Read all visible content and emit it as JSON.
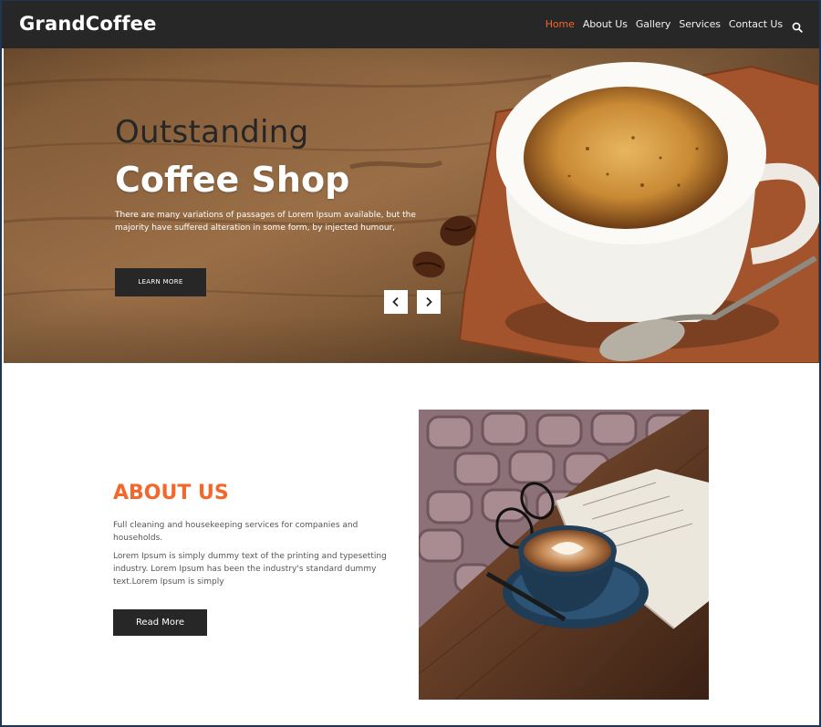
{
  "brand": {
    "name": "GrandCoffee"
  },
  "nav": {
    "items": [
      "Home",
      "About Us",
      "Gallery",
      "Services",
      "Contact Us"
    ],
    "active_index": 0,
    "search_icon": "search-icon"
  },
  "hero": {
    "subtitle": "Outstanding",
    "title": "Coffee Shop",
    "description": "There are many variations of passages of Lorem Ipsum available, but the majority have suffered alteration in some form, by injected humour,",
    "button_label": "LEARN MORE",
    "prev_icon": "chevron-left-icon",
    "next_icon": "chevron-right-icon"
  },
  "about": {
    "title": "ABOUT US",
    "paragraph1": "Full cleaning and housekeeping services for companies and households.",
    "paragraph2": "Lorem Ipsum is simply dummy text of the printing and typesetting industry. Lorem Ipsum has been the industry's standard dummy text.Lorem Ipsum is simply",
    "button_label": "Read More"
  },
  "colors": {
    "accent": "#f4672a",
    "dark": "#272727",
    "text_gray": "#555555",
    "frame_border": "#1d3752"
  }
}
